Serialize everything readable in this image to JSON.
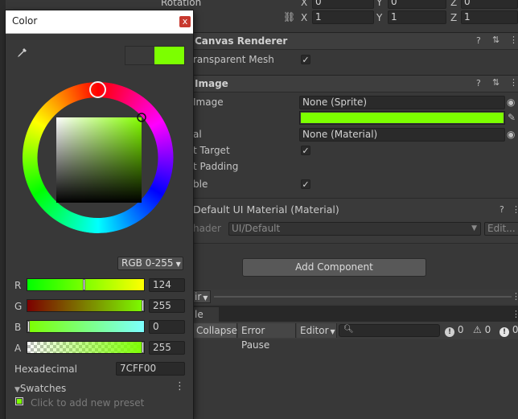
{
  "transform": {
    "rotation_label": "Rotation",
    "rotation": {
      "x": "0",
      "y": "0",
      "z": "0"
    },
    "scale": {
      "x": "1",
      "y": "1",
      "z": "1"
    },
    "axis_x": "X",
    "axis_y": "Y",
    "axis_z": "Z"
  },
  "canvas_renderer": {
    "title": "Canvas Renderer",
    "cull_label": "ransparent Mesh"
  },
  "image": {
    "title": "Image",
    "source_label": "Image",
    "source_value": "None (Sprite)",
    "material_label": "al",
    "material_value": "None (Material)",
    "raycast_label": "t Target",
    "padding_label": "t Padding",
    "maskable_label": "ble",
    "color_hex": "#7CFF00"
  },
  "material": {
    "title": "Default UI Material (Material)",
    "shader_label": "hader",
    "shader_value": "UI/Default",
    "edit_label": "Edit..."
  },
  "add_component_label": "Add Component",
  "console": {
    "tab_label": "le",
    "clear_suffix": "ir",
    "collapse": "Collapse",
    "error_pause": "Error Pause",
    "editor": "Editor",
    "log_count": "0",
    "warn_count": "0",
    "error_count": "0"
  },
  "picker": {
    "title": "Color",
    "close": "x",
    "mode": "RGB 0-255",
    "channels": [
      {
        "label": "R",
        "value": "124",
        "fraction": 0.486
      },
      {
        "label": "G",
        "value": "255",
        "fraction": 1.0
      },
      {
        "label": "B",
        "value": "0",
        "fraction": 0.0
      },
      {
        "label": "A",
        "value": "255",
        "fraction": 1.0
      }
    ],
    "hex_label": "Hexadecimal",
    "hex_value": "7CFF00",
    "swatches_label": "Swatches",
    "preset_hint": "Click to add new preset",
    "current_color": "#7CFF00",
    "hue_deg": 89
  }
}
